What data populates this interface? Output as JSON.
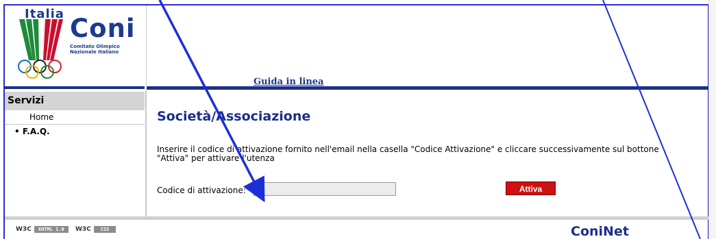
{
  "header": {
    "logo": {
      "italia": "Italia",
      "coni": "Coni",
      "subtitle_line1": "Comitato Olimpico",
      "subtitle_line2": "Nazionale Italiano"
    },
    "help_link": "Guida in linea"
  },
  "sidebar": {
    "heading": "Servizi",
    "items": [
      {
        "label": "Home"
      },
      {
        "label": "• F.A.Q."
      }
    ]
  },
  "main": {
    "title": "Società/Associazione",
    "description_line1": "Inserire il codice di attivazione fornito nell'email nella casella \"Codice Attivazione\" e cliccare successivamente sul bottone",
    "description_line2": "\"Attiva\" per attivare l'utenza",
    "field_label": "Codice di attivazione:",
    "field_value": "",
    "submit_label": "Attiva"
  },
  "footer": {
    "badges": [
      {
        "mark": "W3C",
        "text": "XHTML 1.0"
      },
      {
        "mark": "W3C",
        "text": "CSS"
      }
    ],
    "brand": "ConiNet"
  },
  "colors": {
    "brand_blue": "#1b2f8a",
    "button_red": "#cc1212",
    "annotation_blue": "#1c2fd6"
  },
  "annotations": "arrow-icon"
}
